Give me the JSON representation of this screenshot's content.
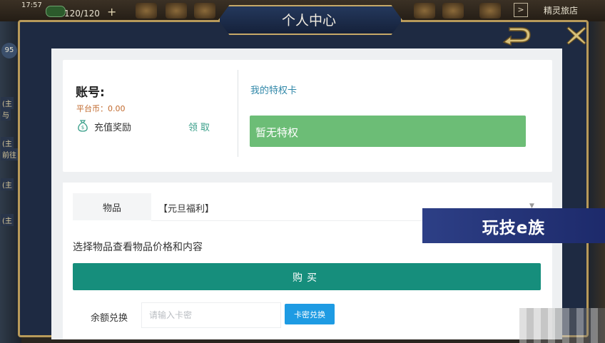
{
  "status_bar": {
    "time": "17:57",
    "stamina": "120/120",
    "plus": "+",
    "top_right_button": ">",
    "top_right_label": "精灵旅店"
  },
  "background": {
    "level": "95",
    "side_labels": [
      "(主",
      "与",
      "(主",
      "前往",
      "(主",
      "(主"
    ]
  },
  "dialog": {
    "title": "个人中心",
    "back_icon": "return-arrow-icon",
    "close_icon": "close-x-icon"
  },
  "account": {
    "label": "账号:",
    "platform_coins": "平台币：0.00",
    "recharge_reward": "充值奖励",
    "claim": "领取"
  },
  "privilege": {
    "title": "我的特权卡",
    "status": "暂无特权"
  },
  "purchase": {
    "item_tab": "物品",
    "selected_item": "【元旦福利】",
    "hint": "选择物品查看物品价格和内容",
    "buy_button": "购买"
  },
  "redeem": {
    "label": "余额兑换",
    "input_placeholder": "请输入卡密",
    "button": "卡密兑换"
  },
  "watermark": {
    "text": "玩技e族"
  },
  "colors": {
    "frame_gold": "#b89a5a",
    "frame_navy": "#1e2a42",
    "privilege_green": "#6cbd76",
    "buy_teal": "#168e7c",
    "redeem_blue": "#1e9be3",
    "coins_orange": "#c26b2f"
  }
}
